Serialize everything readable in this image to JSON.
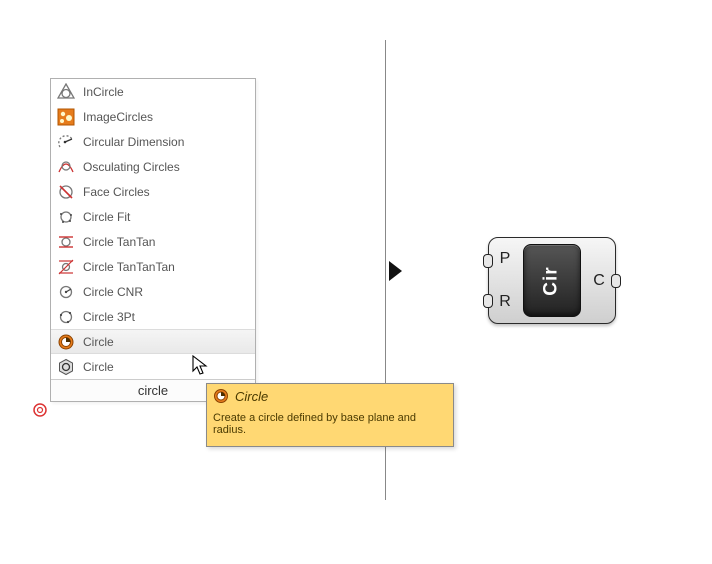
{
  "menu": {
    "items": [
      {
        "label": "InCircle",
        "icon": "incircle"
      },
      {
        "label": "ImageCircles",
        "icon": "imagecircles"
      },
      {
        "label": "Circular Dimension",
        "icon": "circulardim"
      },
      {
        "label": "Osculating Circles",
        "icon": "osculating"
      },
      {
        "label": "Face Circles",
        "icon": "facecircles"
      },
      {
        "label": "Circle Fit",
        "icon": "circlefit"
      },
      {
        "label": "Circle TanTan",
        "icon": "tantan"
      },
      {
        "label": "Circle TanTanTan",
        "icon": "tantantan"
      },
      {
        "label": "Circle CNR",
        "icon": "cnr"
      },
      {
        "label": "Circle 3Pt",
        "icon": "threept"
      },
      {
        "label": "Circle",
        "icon": "circle_orange",
        "highlighted": true
      },
      {
        "label": "Circle",
        "icon": "circle_hex"
      }
    ]
  },
  "search": {
    "value": "circle"
  },
  "tooltip": {
    "title": "Circle",
    "desc": "Create a circle defined by base plane and radius."
  },
  "node": {
    "name": "Cir",
    "inputs": [
      "P",
      "R"
    ],
    "outputs": [
      "C"
    ]
  }
}
